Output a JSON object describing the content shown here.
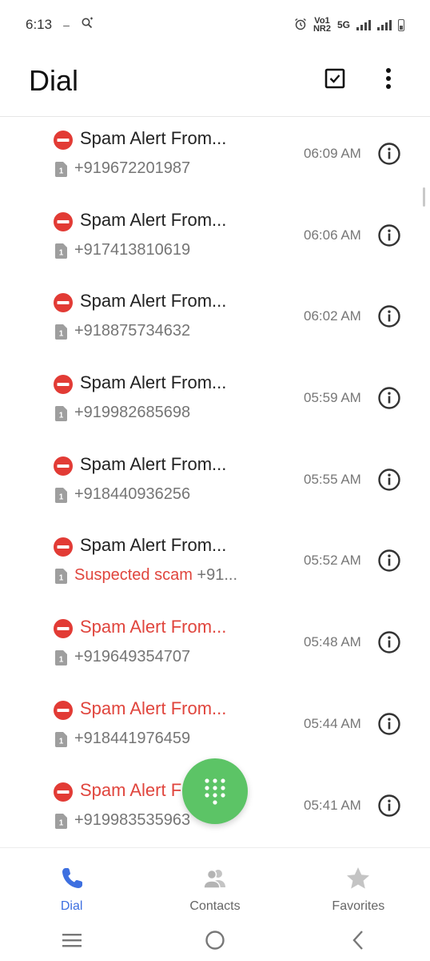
{
  "status_bar": {
    "time": "6:13",
    "dash": "–",
    "network_label": "5G",
    "volte_top": "Vo1",
    "volte_bottom": "NR2"
  },
  "app_bar": {
    "title": "Dial"
  },
  "calls": [
    {
      "name": "Spam Alert From...",
      "name_color": "default",
      "number": "+919672201987",
      "scam_label": "",
      "time": "06:09 AM"
    },
    {
      "name": "Spam Alert From...",
      "name_color": "default",
      "number": "+917413810619",
      "scam_label": "",
      "time": "06:06 AM"
    },
    {
      "name": "Spam Alert From...",
      "name_color": "default",
      "number": "+918875734632",
      "scam_label": "",
      "time": "06:02 AM"
    },
    {
      "name": "Spam Alert From...",
      "name_color": "default",
      "number": "+919982685698",
      "scam_label": "",
      "time": "05:59 AM"
    },
    {
      "name": "Spam Alert From...",
      "name_color": "default",
      "number": "+918440936256",
      "scam_label": "",
      "time": "05:55 AM"
    },
    {
      "name": "Spam Alert From...",
      "name_color": "default",
      "number": "+91...",
      "scam_label": "Suspected scam",
      "time": "05:52 AM"
    },
    {
      "name": "Spam Alert From...",
      "name_color": "red",
      "number": "+919649354707",
      "scam_label": "",
      "time": "05:48 AM"
    },
    {
      "name": "Spam Alert From...",
      "name_color": "red",
      "number": "+918441976459",
      "scam_label": "",
      "time": "05:44 AM"
    },
    {
      "name": "Spam Alert From...",
      "name_color": "red",
      "number": "+919983535963",
      "scam_label": "",
      "time": "05:41 AM"
    }
  ],
  "sim_label": "1",
  "bottom_nav": {
    "dial": "Dial",
    "contacts": "Contacts",
    "favorites": "Favorites"
  },
  "colors": {
    "accent": "#3d6fe0",
    "spam_red": "#e0453d",
    "fab_green": "#5cc466"
  },
  "icons": {
    "spam": "no-entry-icon",
    "sim": "sim-1-icon",
    "info": "info-icon",
    "fab": "dialpad-icon"
  }
}
